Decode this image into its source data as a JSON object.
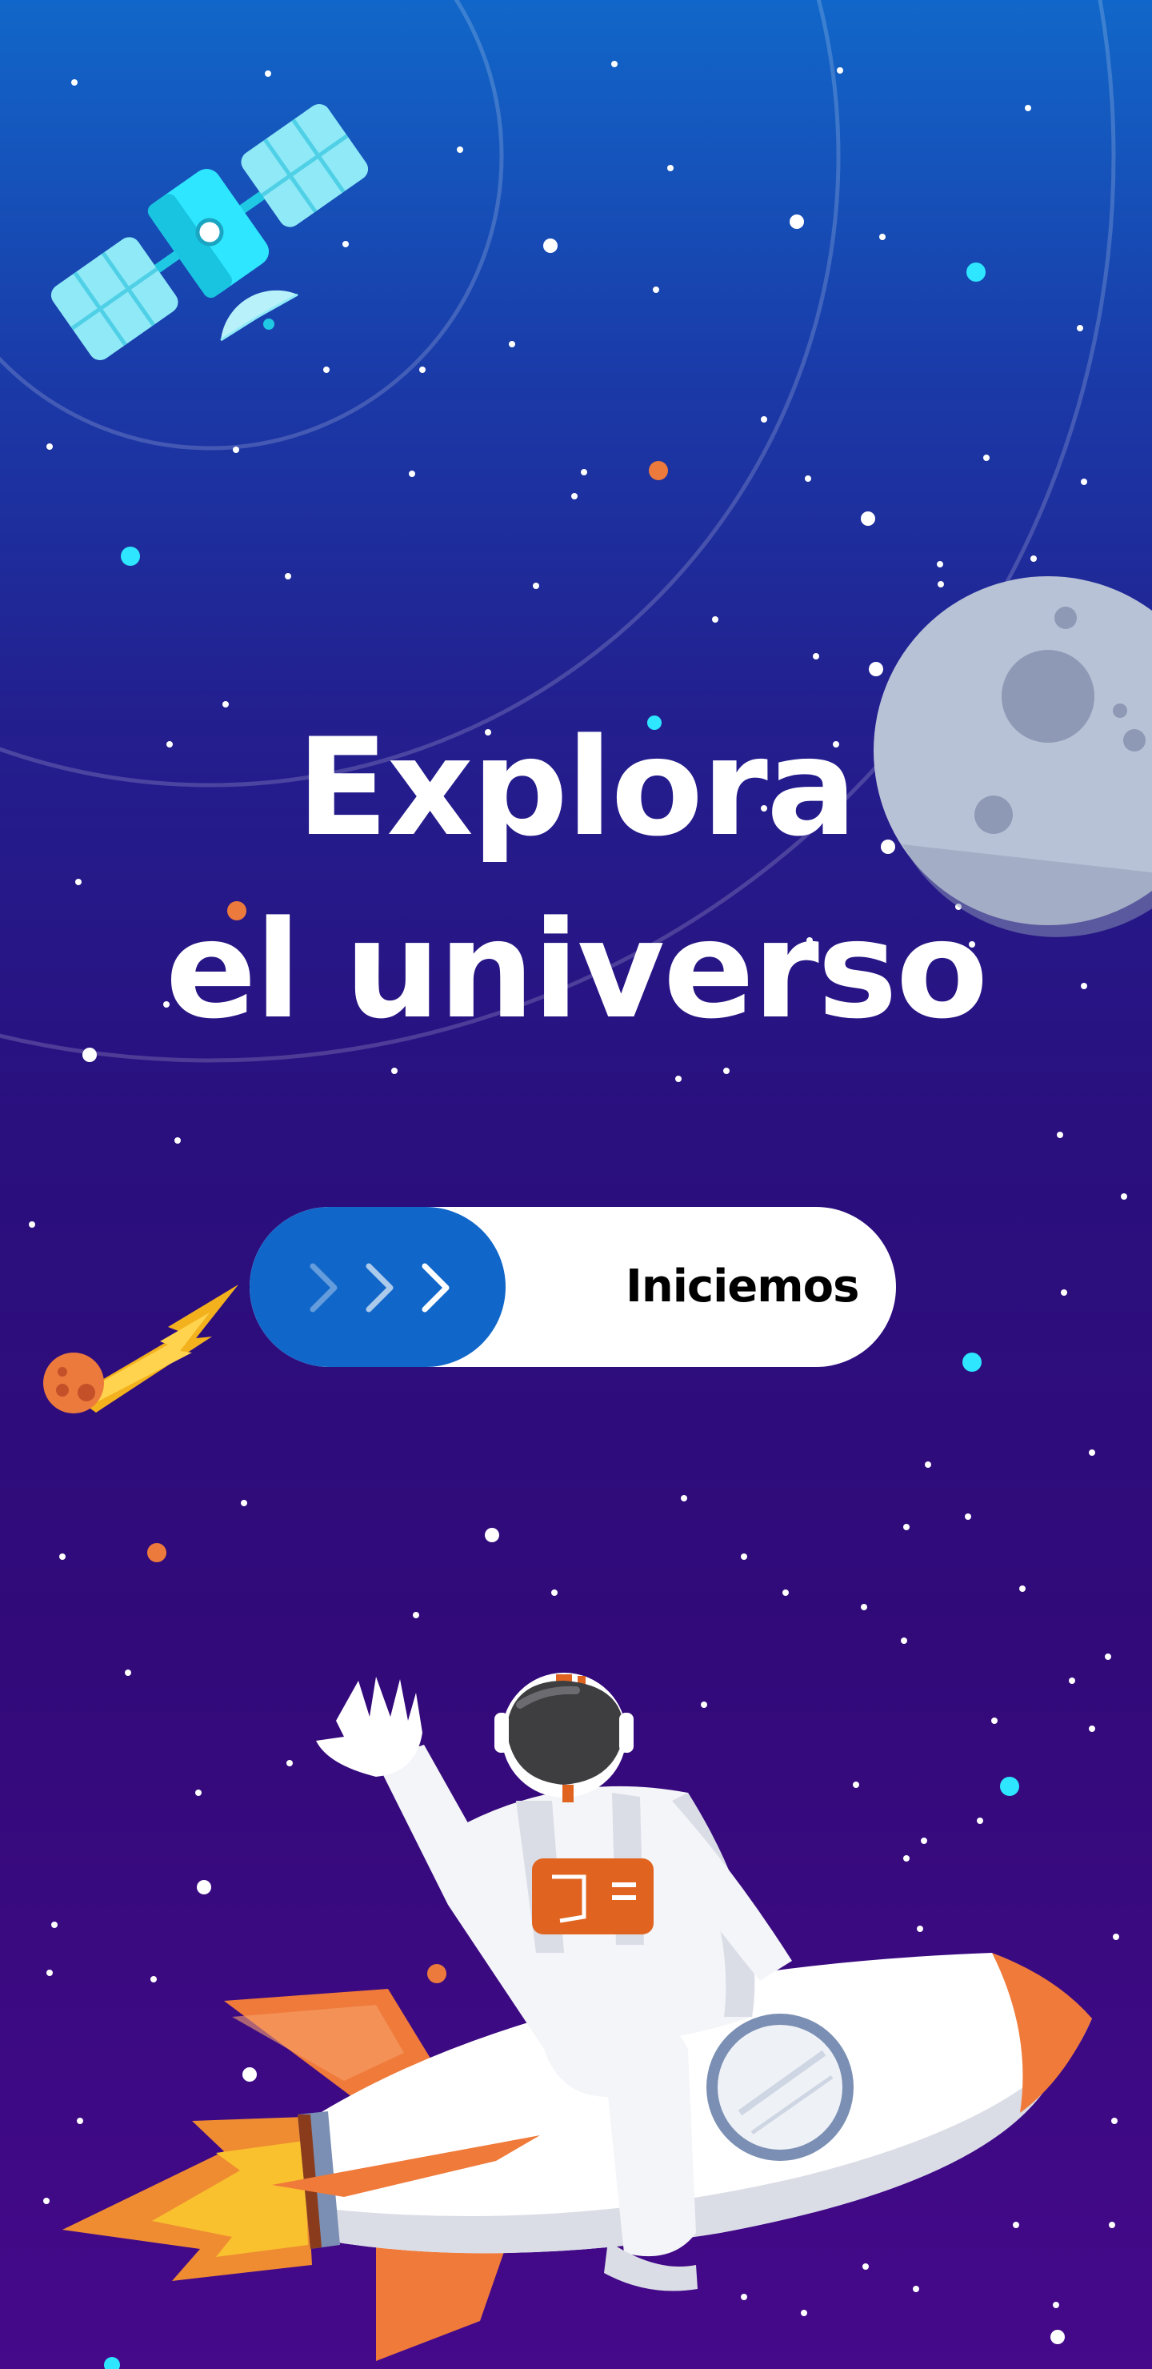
{
  "hero": {
    "line1": "Explora",
    "line2": "el universo"
  },
  "cta": {
    "label": "Iniciemos",
    "handle_icon": "chevron-triple-right-icon"
  },
  "illustrations": [
    "satellite-icon",
    "moon-icon",
    "comet-icon",
    "astronaut-icon",
    "rocket-icon"
  ],
  "colors": {
    "background_top": "#1167c9",
    "background_bottom": "#45098a",
    "accent_blue": "#1167c9",
    "button_white": "#ffffff",
    "cta_text": "#000000",
    "star_cyan": "#2ee6ff",
    "star_orange": "#ec7a3c"
  }
}
